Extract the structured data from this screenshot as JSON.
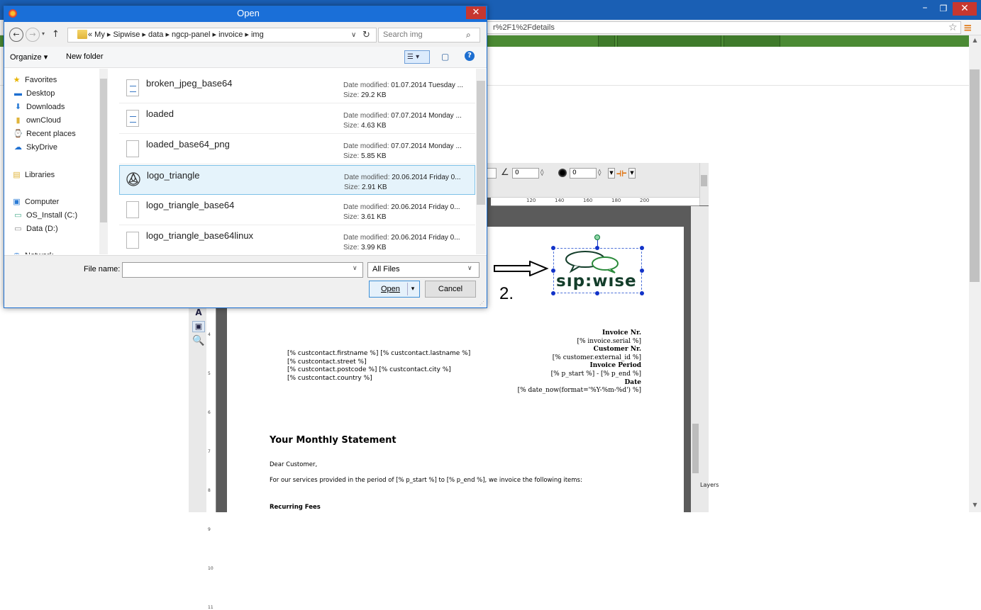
{
  "browser": {
    "url_fragment": "r%2F1%2Fdetails",
    "minimize_glyph": "–",
    "maximize_glyph": "❐",
    "close_glyph": "✕",
    "star_glyph": "☆",
    "menu_glyph": "≡"
  },
  "dialog": {
    "title": "Open",
    "close_glyph": "✕",
    "nav": {
      "back": "←",
      "forward": "→",
      "recent": "▾",
      "up": "↑"
    },
    "breadcrumb": "«  My  ▸  Sipwise  ▸  data  ▸  ngcp-panel  ▸  invoice  ▸  img",
    "breadcrumb_dropdown": "∨",
    "refresh_glyph": "↻",
    "search_placeholder": "Search img",
    "search_glyph": "⌕",
    "organize_label": "Organize ▾",
    "new_folder_label": "New folder",
    "view_glyph": "☰ ▾",
    "pane_glyph": "▢",
    "help_glyph": "?",
    "nav_items": [
      {
        "label": "Favorites",
        "icon": "★",
        "icon_name": "star-icon",
        "color": "#e8b400"
      },
      {
        "label": "Desktop",
        "icon": "▬",
        "icon_name": "desktop-icon",
        "color": "#1d6fd1"
      },
      {
        "label": "Downloads",
        "icon": "⬇",
        "icon_name": "downloads-icon",
        "color": "#2a7bd6"
      },
      {
        "label": "ownCloud",
        "icon": "▮",
        "icon_name": "folder-icon",
        "color": "#e0b43a"
      },
      {
        "label": "Recent places",
        "icon": "⌚",
        "icon_name": "recent-places-icon",
        "color": "#6a6a6a"
      },
      {
        "label": "SkyDrive",
        "icon": "☁",
        "icon_name": "cloud-icon",
        "color": "#1d6fd1"
      },
      {
        "label": "Libraries",
        "icon": "▤",
        "icon_name": "libraries-icon",
        "color": "#e0b43a"
      },
      {
        "label": "Computer",
        "icon": "▣",
        "icon_name": "computer-icon",
        "color": "#2a7bd6"
      },
      {
        "label": "OS_Install (C:)",
        "icon": "▭",
        "icon_name": "drive-icon",
        "color": "#4a8"
      },
      {
        "label": "Data (D:)",
        "icon": "▭",
        "icon_name": "drive-icon",
        "color": "#888"
      },
      {
        "label": "Network",
        "icon": "◉",
        "icon_name": "network-icon",
        "color": "#2a7bd6"
      }
    ],
    "files": [
      {
        "name": "broken_jpeg_base64",
        "date": "01.07.2014 Tuesday ...",
        "size": "29.2 KB",
        "icon": "text-file-icon"
      },
      {
        "name": "loaded",
        "date": "07.07.2014 Monday ...",
        "size": "4.63 KB",
        "icon": "text-file-icon"
      },
      {
        "name": "loaded_base64_png",
        "date": "07.07.2014 Monday ...",
        "size": "5.85 KB",
        "icon": "file-icon"
      },
      {
        "name": "logo_triangle",
        "date": "20.06.2014 Friday 0...",
        "size": "2.91 KB",
        "icon": "triquetra-image-icon",
        "selected": true
      },
      {
        "name": "logo_triangle_base64",
        "date": "20.06.2014 Friday 0...",
        "size": "3.61 KB",
        "icon": "file-icon"
      },
      {
        "name": "logo_triangle_base64linux",
        "date": "20.06.2014 Friday 0...",
        "size": "3.99 KB",
        "icon": "file-icon"
      }
    ],
    "date_label": "Date modified: ",
    "size_label": "Size: ",
    "filename_label": "File name:",
    "filename_value": "",
    "filetype_value": "All Files",
    "open_label": "Open",
    "cancel_label": "Cancel",
    "dropdown_glyph": "∨",
    "split_glyph": "▾"
  },
  "editor": {
    "angle_value": "0",
    "blur_value": "0",
    "ruler_labels": [
      "120",
      "140",
      "160",
      "180",
      "200"
    ],
    "vruler_labels": [
      "4",
      "5",
      "6",
      "7",
      "8",
      "9",
      "10",
      "11"
    ],
    "layers_label": "Layers",
    "tools": {
      "text": "A",
      "image": "▣",
      "zoom": "🔍"
    }
  },
  "invoice": {
    "logo_text": "sıp:wıse",
    "step_label": "2.",
    "right_block": [
      {
        "text": "Invoice Nr.",
        "bold": true
      },
      {
        "text": "[% invoice.serial %]",
        "bold": false
      },
      {
        "text": "Customer Nr.",
        "bold": true
      },
      {
        "text": "[% customer.external_id %]",
        "bold": false
      },
      {
        "text": "Invoice Period",
        "bold": true
      },
      {
        "text": "[% p_start %] - [% p_end %]",
        "bold": false
      },
      {
        "text": "Date",
        "bold": true
      },
      {
        "text": "[% date_now(format='%Y-%m-%d') %]",
        "bold": false
      }
    ],
    "address_lines": [
      "[% custcontact.firstname %] [% custcontact.lastname %]",
      "[% custcontact.street %]",
      "[% custcontact.postcode %] [% custcontact.city %]",
      "[% custcontact.country %]"
    ],
    "statement_title": "Your Monthly Statement",
    "greeting": "Dear Customer,",
    "services_line": "For our services provided in the period of [% p_start %] to [% p_end %], we invoice the following items:",
    "recurring_title": "Recurring Fees"
  }
}
